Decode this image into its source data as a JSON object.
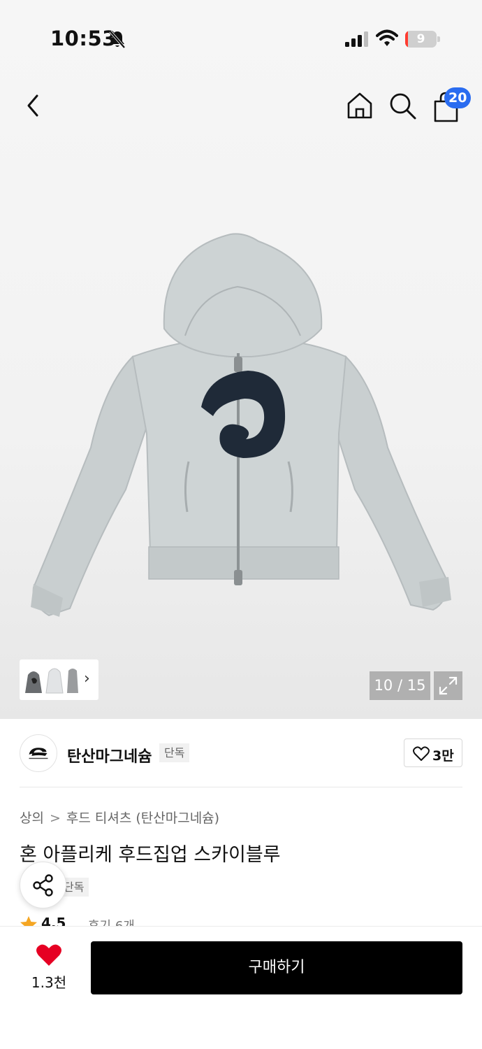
{
  "status_bar": {
    "time": "10:53",
    "battery_level": "9",
    "battery_fraction": 0.09
  },
  "header": {
    "cart_badge": "20"
  },
  "gallery": {
    "page_counter": "10 / 15"
  },
  "brand": {
    "name": "탄산마그네슘",
    "tag": "단독",
    "likes": "3만"
  },
  "breadcrumb": {
    "category": "상의",
    "separator": ">",
    "subcategory": "후드 티셔츠 (탄산마그네슘)"
  },
  "product": {
    "title": "혼 아플리케 후드집업 스카이블루",
    "tag": "단독",
    "rating": "4.5",
    "reviews": "후기 6개"
  },
  "bottom": {
    "wish_count": "1.3천",
    "buy_label": "구매하기"
  },
  "icons": {
    "back": "chevron-left-icon",
    "home": "home-icon",
    "search": "search-icon",
    "cart": "shopping-bag-icon",
    "expand": "expand-icon",
    "share": "share-icon",
    "like": "heart-outline-icon",
    "wish": "heart-filled-icon",
    "star": "star-icon"
  },
  "colors": {
    "cart_badge": "#2a6cf0",
    "buy_button": "#000000",
    "wish_heart": "#e60023",
    "rating_star": "#f5a623",
    "battery_low": "#ff3b30"
  }
}
